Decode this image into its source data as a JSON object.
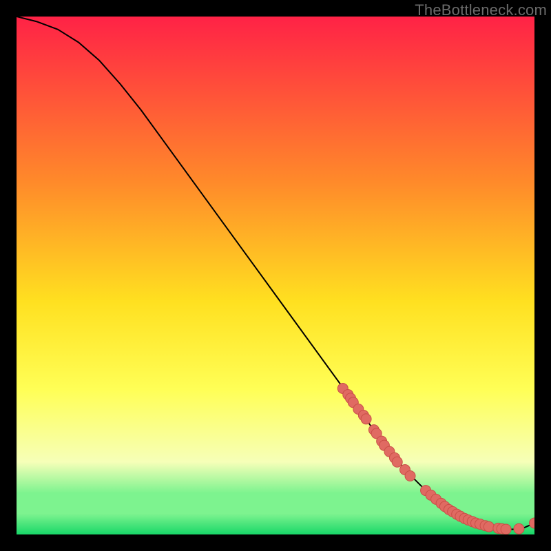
{
  "watermark": "TheBottleneck.com",
  "colors": {
    "background": "#000000",
    "curve": "#000000",
    "point_fill": "#e06a62",
    "point_stroke": "#c94f47",
    "gradient_top": "#ff2246",
    "gradient_mid1": "#ff8a2a",
    "gradient_mid2": "#ffe020",
    "gradient_mid3": "#ffff56",
    "gradient_pale": "#f6ffb8",
    "gradient_green_light": "#7df38f",
    "gradient_green": "#18d768"
  },
  "chart_data": {
    "type": "line",
    "title": "",
    "xlabel": "",
    "ylabel": "",
    "xlim": [
      0,
      100
    ],
    "ylim": [
      0,
      100
    ],
    "series": [
      {
        "name": "bottleneck-curve",
        "x": [
          0,
          4,
          8,
          12,
          16,
          20,
          24,
          28,
          32,
          36,
          40,
          44,
          48,
          52,
          56,
          60,
          64,
          68,
          70,
          72,
          74,
          76,
          78,
          80,
          82,
          84,
          86,
          88,
          90,
          92,
          94,
          96,
          98,
          100
        ],
        "y": [
          100,
          99,
          97.5,
          95,
          91.5,
          87,
          82,
          76.5,
          71,
          65.5,
          60,
          54.5,
          49,
          43.5,
          38,
          32.5,
          27,
          21.5,
          18.8,
          16.2,
          13.8,
          11.5,
          9.5,
          7.6,
          6.0,
          4.6,
          3.4,
          2.5,
          1.8,
          1.3,
          1.0,
          1.0,
          1.3,
          2.2
        ]
      }
    ],
    "scatter": {
      "name": "gpu-points",
      "points": [
        [
          63,
          28.2
        ],
        [
          64,
          27.0
        ],
        [
          64.5,
          26.3
        ],
        [
          65,
          25.5
        ],
        [
          66,
          24.2
        ],
        [
          67,
          23.0
        ],
        [
          67.5,
          22.3
        ],
        [
          69,
          20.2
        ],
        [
          69.5,
          19.5
        ],
        [
          70.5,
          18.0
        ],
        [
          71,
          17.2
        ],
        [
          72,
          16.0
        ],
        [
          73,
          14.8
        ],
        [
          73.5,
          14.0
        ],
        [
          75,
          12.5
        ],
        [
          76,
          11.3
        ],
        [
          79,
          8.5
        ],
        [
          80,
          7.6
        ],
        [
          81,
          6.8
        ],
        [
          82,
          6.0
        ],
        [
          82.7,
          5.4
        ],
        [
          83.5,
          4.8
        ],
        [
          84.2,
          4.4
        ],
        [
          85,
          3.9
        ],
        [
          85.7,
          3.5
        ],
        [
          86.5,
          3.1
        ],
        [
          87.2,
          2.8
        ],
        [
          88,
          2.5
        ],
        [
          88.7,
          2.2
        ],
        [
          89.5,
          2.0
        ],
        [
          90.5,
          1.7
        ],
        [
          91.2,
          1.5
        ],
        [
          93,
          1.2
        ],
        [
          93.7,
          1.1
        ],
        [
          94.5,
          1.0
        ],
        [
          97,
          1.1
        ],
        [
          100,
          2.2
        ]
      ]
    }
  }
}
